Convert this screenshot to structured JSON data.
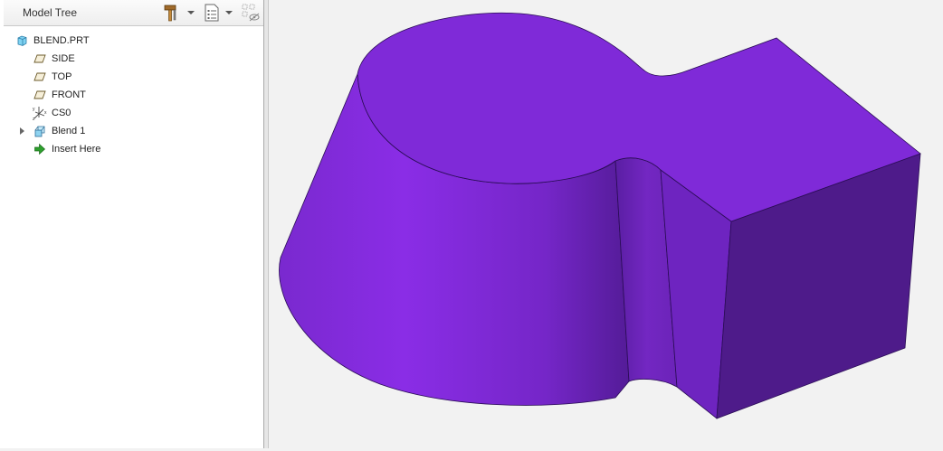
{
  "panel": {
    "title": "Model Tree",
    "header_buttons": [
      {
        "name": "tree-settings",
        "icon": "hammer-icon"
      },
      {
        "name": "show-options",
        "icon": "list-icon"
      },
      {
        "name": "hide-columns",
        "icon": "columns-icon"
      }
    ]
  },
  "tree": {
    "items": [
      {
        "label": "BLEND.PRT",
        "icon": "part-icon",
        "indent": 0
      },
      {
        "label": "SIDE",
        "icon": "datum-plane-icon",
        "indent": 1
      },
      {
        "label": "TOP",
        "icon": "datum-plane-icon",
        "indent": 1
      },
      {
        "label": "FRONT",
        "icon": "datum-plane-icon",
        "indent": 1
      },
      {
        "label": "CS0",
        "icon": "coordinate-system-icon",
        "indent": 1
      },
      {
        "label": "Blend 1",
        "icon": "blend-feature-icon",
        "indent": 1,
        "expandable": true
      },
      {
        "label": "Insert Here",
        "icon": "insert-arrow-icon",
        "indent": 1
      }
    ]
  },
  "model": {
    "color": "#7e2ad8",
    "dark_color": "#4e1b8a",
    "edge_color": "#2a0d55"
  }
}
